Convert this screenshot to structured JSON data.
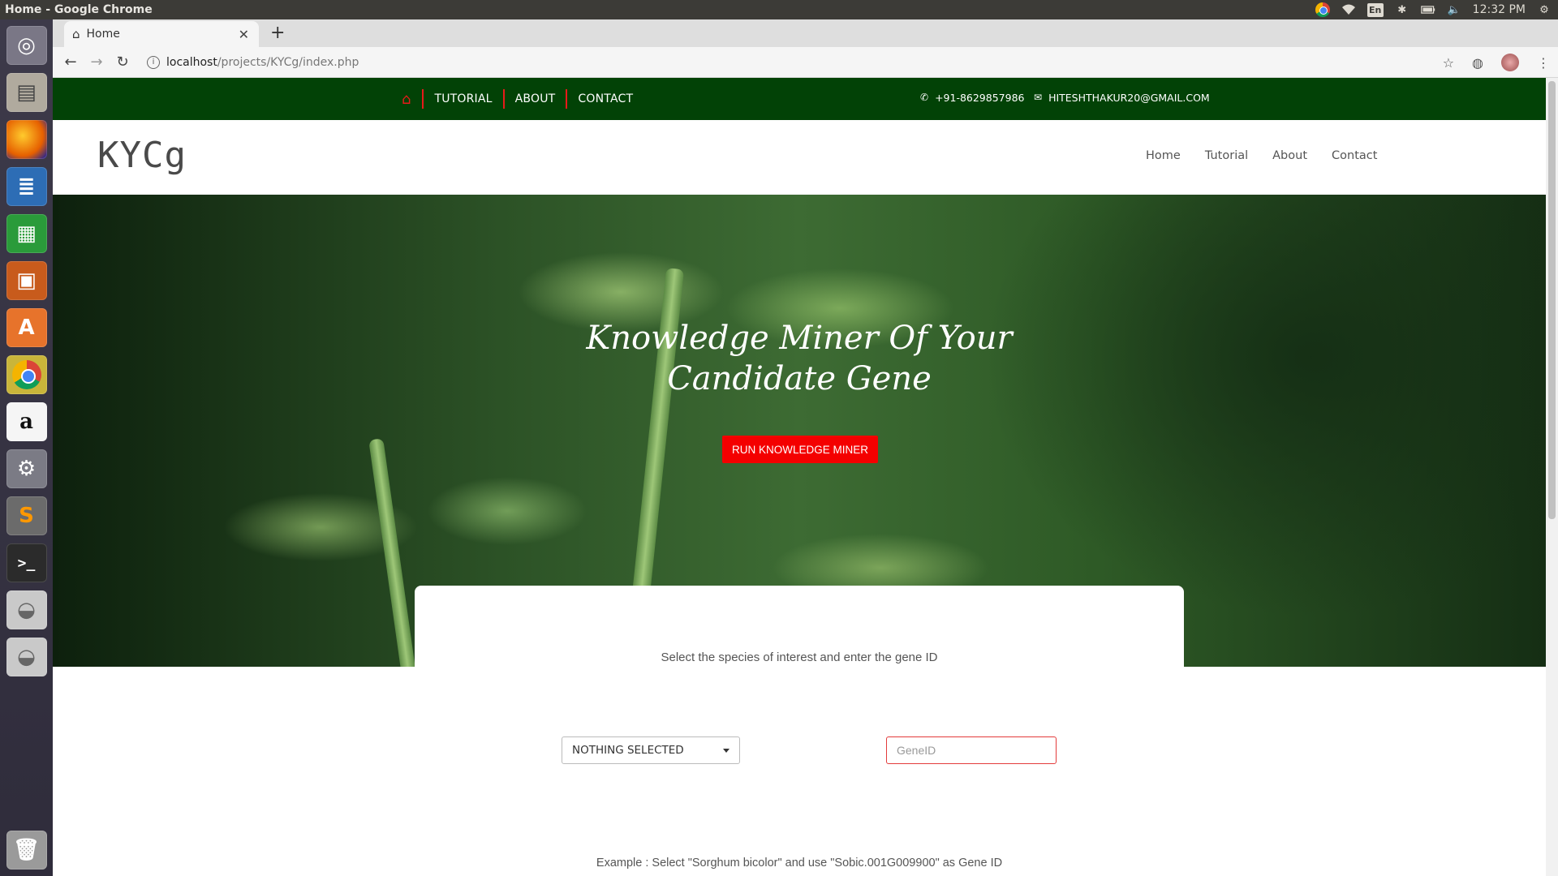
{
  "os": {
    "window_title": "Home - Google Chrome",
    "keyboard_layout": "En",
    "clock": "12:32 PM"
  },
  "browser": {
    "tab_title": "Home",
    "new_tab_symbol": "+",
    "url_host": "localhost",
    "url_path": "/projects/KYCg/index.php"
  },
  "topbar": {
    "nav": [
      "TUTORIAL",
      "ABOUT",
      "CONTACT"
    ],
    "phone": "+91-8629857986",
    "email": "HITESHTHAKUR20@GMAIL.COM",
    "background": "#024206",
    "accent": "#e81a1a"
  },
  "header": {
    "logo": "KYCg",
    "nav": [
      "Home",
      "Tutorial",
      "About",
      "Contact"
    ]
  },
  "hero": {
    "title_line1": "Knowledge Miner Of Your",
    "title_line2": "Candidate Gene",
    "button_label": "RUN KNOWLEDGE MINER",
    "button_color": "#f40000"
  },
  "form": {
    "instruction": "Select the species of interest and enter the gene ID",
    "species_selected": "NOTHING SELECTED",
    "gene_placeholder": "GeneID",
    "example": "Example : Select \"Sorghum bicolor\" and use \"Sobic.001G009900\" as Gene ID"
  },
  "icons": {
    "tab": "home-icon",
    "topbar_home": "home-icon",
    "phone": "phone-icon",
    "email": "envelope-icon"
  }
}
